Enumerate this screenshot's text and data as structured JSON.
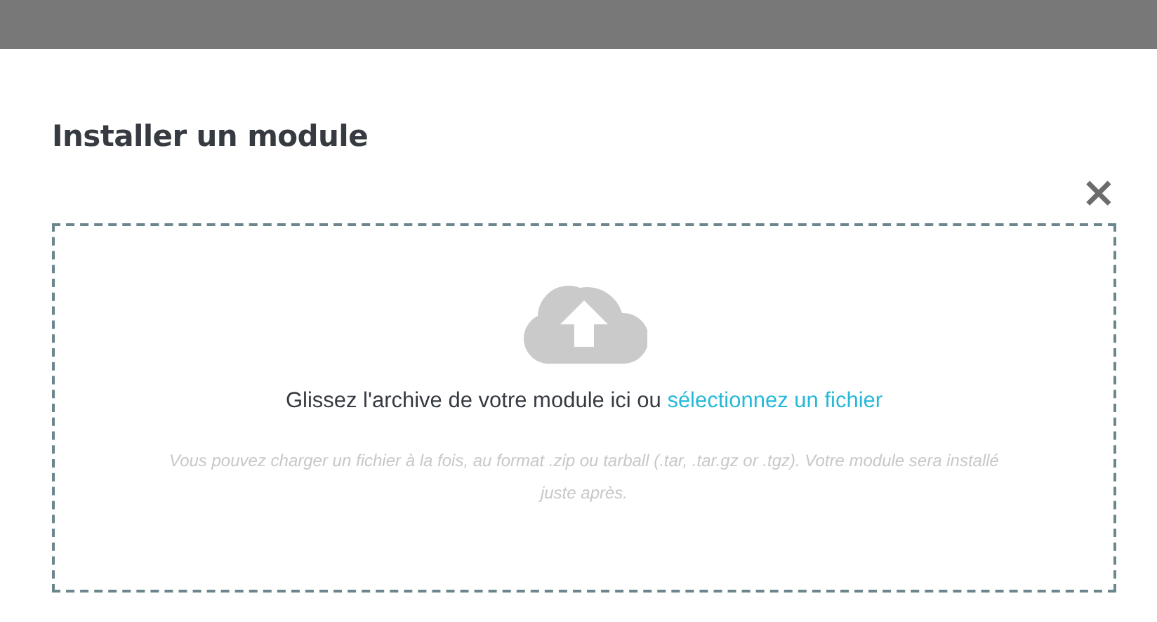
{
  "modal": {
    "title": "Installer un module",
    "close": "×"
  },
  "dropzone": {
    "prompt": "Glissez l'archive de votre module ici ou",
    "link": "sélectionnez un fichier",
    "hint": "Vous pouvez charger un fichier à la fois, au format .zip ou tarball (.tar, .tar.gz or .tgz). Votre module sera installé juste après."
  }
}
